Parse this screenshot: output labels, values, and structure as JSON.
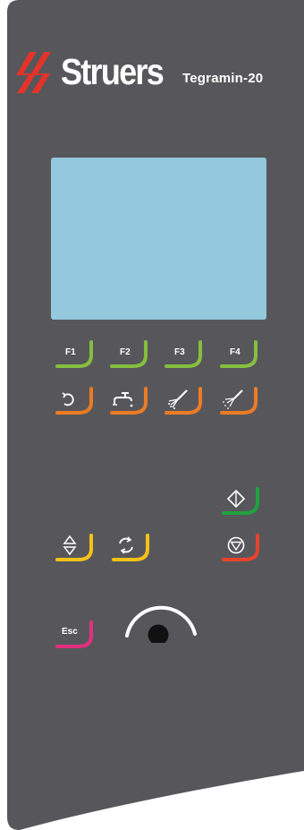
{
  "brand": {
    "name": "Struers",
    "model": "Tegramin-20"
  },
  "function_keys": [
    {
      "label": "F1"
    },
    {
      "label": "F2"
    },
    {
      "label": "F3"
    },
    {
      "label": "F4"
    }
  ],
  "action_keys": [
    {
      "icon": "rotation-arrow-icon"
    },
    {
      "icon": "water-tap-icon"
    },
    {
      "icon": "spray-nozzle-icon"
    },
    {
      "icon": "lubricant-spray-icon"
    }
  ],
  "control_keys": {
    "start_icon": "start-diamond-icon",
    "stop_icon": "stop-circle-icon",
    "up_down_icon": "up-down-arrows-icon",
    "cycle_icon": "cycle-arrows-icon",
    "escape_label": "Esc",
    "enter_icon": "enter-return-icon",
    "knob_icon": "rotary-knob-icon"
  },
  "colors": {
    "panel": "#57575b",
    "display": "#93c8dd",
    "function_key": "#86bf3f",
    "action_key": "#ec7b25",
    "start_key": "#1fa23e",
    "stop_key": "#e8432c",
    "nav_key": "#f5c118",
    "escape_key": "#e0307f"
  }
}
